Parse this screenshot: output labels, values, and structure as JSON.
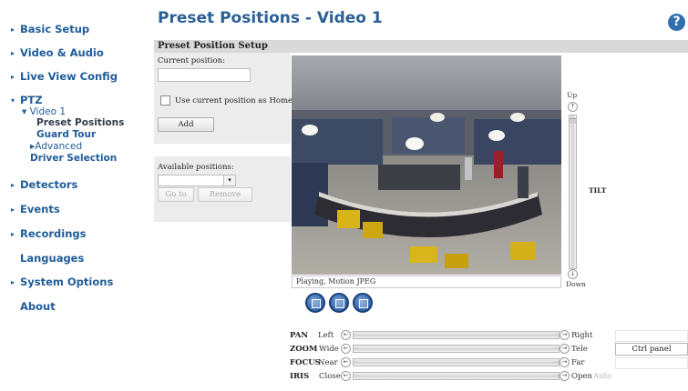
{
  "nav": {
    "items": [
      {
        "label": "Basic Setup",
        "arrow": "▸"
      },
      {
        "label": "Video & Audio",
        "arrow": "▸"
      },
      {
        "label": "Live View Config",
        "arrow": "▸"
      },
      {
        "label": "PTZ",
        "arrow": "▾"
      },
      {
        "label": "Detectors",
        "arrow": "▸"
      },
      {
        "label": "Events",
        "arrow": "▸"
      },
      {
        "label": "Recordings",
        "arrow": "▸"
      },
      {
        "label": "Languages",
        "arrow": ""
      },
      {
        "label": "System Options",
        "arrow": "▸"
      },
      {
        "label": "About",
        "arrow": ""
      }
    ],
    "ptz_sub": {
      "video1": "▾ Video 1",
      "preset_positions": "Preset Positions",
      "guard_tour": "Guard Tour",
      "advanced": "▸Advanced",
      "driver_selection": "Driver Selection"
    }
  },
  "header": {
    "title": "Preset Positions - Video 1",
    "help": "?"
  },
  "section": {
    "title": "Preset Position Setup"
  },
  "form": {
    "current_position_label": "Current position:",
    "current_position_value": "",
    "use_as_home_label": "Use current position as Home",
    "add_label": "Add",
    "available_positions_label": "Available positions:",
    "goto_label": "Go to",
    "remove_label": "Remove"
  },
  "video": {
    "status": "Playing, Motion JPEG"
  },
  "tilt": {
    "up": "Up",
    "down": "Down",
    "label": "TILT",
    "level": 0.02
  },
  "ptz_rows": [
    {
      "name": "PAN",
      "left": "Left",
      "right": "Right"
    },
    {
      "name": "ZOOM",
      "left": "Wide",
      "right": "Tele"
    },
    {
      "name": "FOCUS",
      "left": "Near",
      "right": "Far"
    },
    {
      "name": "IRIS",
      "left": "Close",
      "right": "Open",
      "extra": "Auto"
    }
  ],
  "ctrl_panel_label": "Ctrl panel",
  "colors": {
    "link": "#1f5c99",
    "title": "#2b5f94",
    "section_bar": "#d9d9d9",
    "panel": "#ececec"
  }
}
